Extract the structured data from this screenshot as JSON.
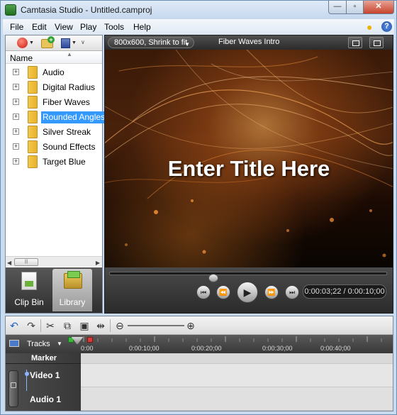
{
  "window": {
    "title": "Camtasia Studio - Untitled.camproj",
    "minimize_glyph": "—",
    "maximize_glyph": "▫",
    "close_glyph": "✕"
  },
  "menu": {
    "items": [
      {
        "label": "File"
      },
      {
        "label": "Edit"
      },
      {
        "label": "View"
      },
      {
        "label": "Play"
      },
      {
        "label": "Tools"
      },
      {
        "label": "Help"
      }
    ],
    "help_glyph": "?"
  },
  "library": {
    "column_header": "Name",
    "folders": [
      {
        "label": "Audio"
      },
      {
        "label": "Digital Radius"
      },
      {
        "label": "Fiber Waves"
      },
      {
        "label": "Rounded Angles"
      },
      {
        "label": "Silver Streak"
      },
      {
        "label": "Sound Effects"
      },
      {
        "label": "Target Blue"
      }
    ],
    "selected_folder": "Rounded Angles",
    "expander_glyph": "+",
    "tabs": [
      {
        "label": "Clip Bin"
      },
      {
        "label": "Library"
      }
    ],
    "active_tab": "Library"
  },
  "preview": {
    "zoom_option": "800x600, Shrink to fit",
    "project_name": "Fiber Waves Intro",
    "title_text": "Enter Title Here",
    "time_display": "0:00:03;22 / 0:00:10;00",
    "position_fraction": 0.37
  },
  "timeline": {
    "tracks_label": "Tracks",
    "ruler": [
      "0:00",
      "0:00:10;00",
      "0:00:20;00",
      "0:00:30;00",
      "0:00:40;00"
    ],
    "marker_label": "Marker",
    "tracks": [
      {
        "name": "Video 1"
      },
      {
        "name": "Audio 1"
      }
    ]
  },
  "icons": {
    "undo": "undo-icon",
    "redo": "redo-icon",
    "cut": "scissors-icon",
    "copy": "copy-icon",
    "paste": "paste-icon",
    "split": "split-icon",
    "zoom_out": "zoom-out-icon",
    "zoom_in": "zoom-in-icon"
  },
  "colors": {
    "selection": "#3399ff",
    "window_frame": "#c9dbef",
    "close_button": "#c7432c"
  }
}
